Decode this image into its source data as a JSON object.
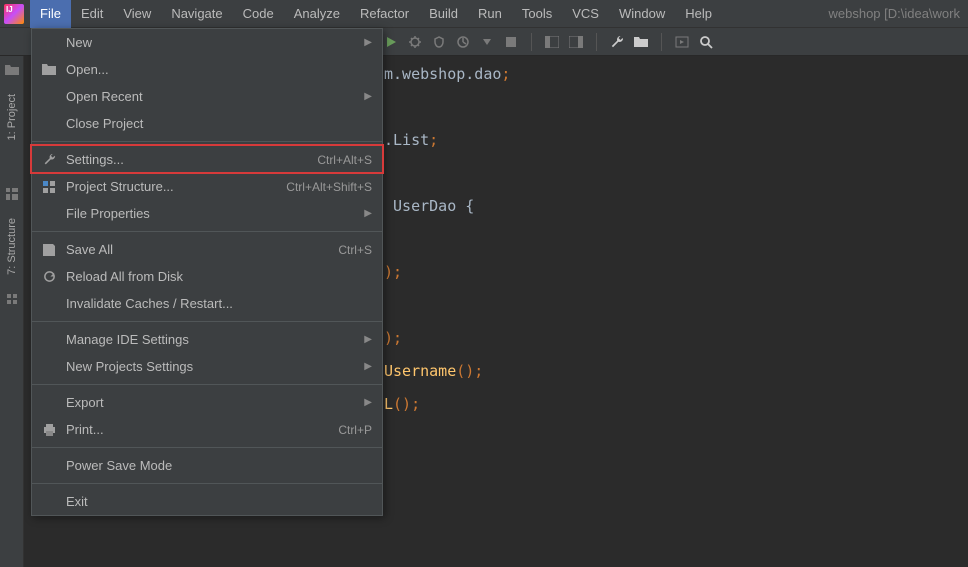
{
  "menubar": {
    "items": [
      "File",
      "Edit",
      "View",
      "Navigate",
      "Code",
      "Analyze",
      "Refactor",
      "Build",
      "Run",
      "Tools",
      "VCS",
      "Window",
      "Help"
    ],
    "active_index": 0,
    "project_path": "webshop [D:\\idea\\work"
  },
  "file_menu": {
    "groups": [
      [
        {
          "label": "New",
          "shortcut": "",
          "arrow": true,
          "icon": ""
        },
        {
          "label": "Open...",
          "shortcut": "",
          "arrow": false,
          "icon": "folder"
        },
        {
          "label": "Open Recent",
          "shortcut": "",
          "arrow": true,
          "icon": ""
        },
        {
          "label": "Close Project",
          "shortcut": "",
          "arrow": false,
          "icon": ""
        }
      ],
      [
        {
          "label": "Settings...",
          "shortcut": "Ctrl+Alt+S",
          "arrow": false,
          "icon": "wrench",
          "highlighted": true
        },
        {
          "label": "Project Structure...",
          "shortcut": "Ctrl+Alt+Shift+S",
          "arrow": false,
          "icon": "structure"
        },
        {
          "label": "File Properties",
          "shortcut": "",
          "arrow": true,
          "icon": ""
        }
      ],
      [
        {
          "label": "Save All",
          "shortcut": "Ctrl+S",
          "arrow": false,
          "icon": "save"
        },
        {
          "label": "Reload All from Disk",
          "shortcut": "",
          "arrow": false,
          "icon": "reload"
        },
        {
          "label": "Invalidate Caches / Restart...",
          "shortcut": "",
          "arrow": false,
          "icon": ""
        }
      ],
      [
        {
          "label": "Manage IDE Settings",
          "shortcut": "",
          "arrow": true,
          "icon": ""
        },
        {
          "label": "New Projects Settings",
          "shortcut": "",
          "arrow": true,
          "icon": ""
        }
      ],
      [
        {
          "label": "Export",
          "shortcut": "",
          "arrow": true,
          "icon": ""
        },
        {
          "label": "Print...",
          "shortcut": "Ctrl+P",
          "arrow": false,
          "icon": "print"
        }
      ],
      [
        {
          "label": "Power Save Mode",
          "shortcut": "",
          "arrow": false,
          "icon": ""
        }
      ],
      [
        {
          "label": "Exit",
          "shortcut": "",
          "arrow": false,
          "icon": ""
        }
      ]
    ]
  },
  "sidebar": {
    "tool1": "1: Project",
    "tool2": "7: Structure"
  },
  "editor": {
    "lines": [
      {
        "frag": [
          {
            "t": "m.webshop.dao",
            "c": "pkg"
          },
          {
            "t": ";",
            "c": "punct"
          }
        ]
      },
      {
        "frag": []
      },
      {
        "frag": [
          {
            "t": ".List",
            "c": "typ"
          },
          {
            "t": ";",
            "c": "punct"
          }
        ]
      },
      {
        "frag": []
      },
      {
        "frag": [
          {
            "t": " UserDao {",
            "c": "cls"
          }
        ]
      },
      {
        "frag": []
      },
      {
        "frag": [
          {
            "t": ");",
            "c": "punct"
          }
        ]
      },
      {
        "frag": []
      },
      {
        "frag": [
          {
            "t": ");",
            "c": "punct"
          }
        ]
      },
      {
        "frag": [
          {
            "t": "Username",
            "c": "method"
          },
          {
            "t": "();",
            "c": "punct"
          }
        ]
      },
      {
        "frag": [
          {
            "t": "L",
            "c": "method"
          },
          {
            "t": "();",
            "c": "punct"
          }
        ]
      }
    ]
  },
  "toolbar_icons": [
    "run",
    "debug",
    "coverage",
    "profile",
    "more",
    "stop",
    "sep",
    "layout1",
    "layout2",
    "sep",
    "wrench",
    "folder",
    "sep",
    "deploy",
    "search"
  ]
}
